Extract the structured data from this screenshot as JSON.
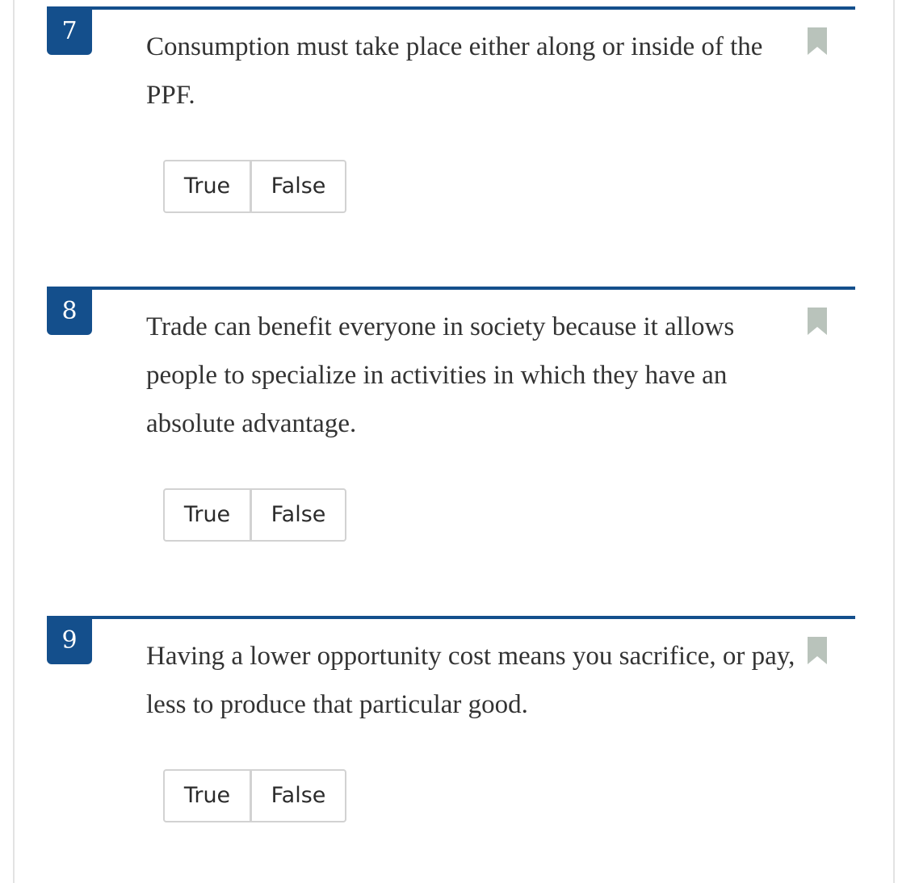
{
  "colors": {
    "accent": "#144f8c",
    "bookmark": "#b9c3bb",
    "button_border": "#d2d2d2",
    "text": "#333333"
  },
  "questions": [
    {
      "number": "7",
      "text": "Consumption must take place either along or inside of the PPF.",
      "options": {
        "true_label": "True",
        "false_label": "False"
      },
      "bookmark_icon": "bookmark-icon"
    },
    {
      "number": "8",
      "text": "Trade can benefit everyone in society because it allows people to specialize in activities in which they have an absolute advantage.",
      "options": {
        "true_label": "True",
        "false_label": "False"
      },
      "bookmark_icon": "bookmark-icon"
    },
    {
      "number": "9",
      "text": "Having a lower opportunity cost means you sacrifice, or pay, less to produce that particular good.",
      "options": {
        "true_label": "True",
        "false_label": "False"
      },
      "bookmark_icon": "bookmark-icon"
    }
  ]
}
